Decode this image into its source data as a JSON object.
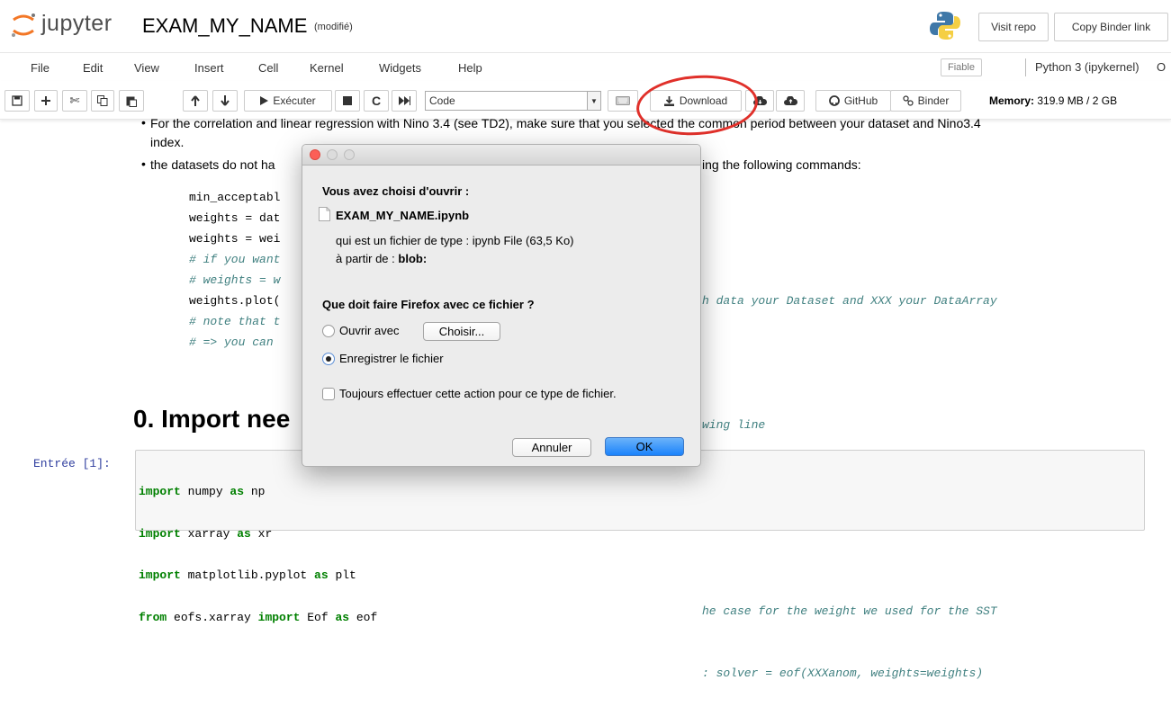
{
  "header": {
    "logo_text": "jupyter",
    "notebook_title": "EXAM_MY_NAME",
    "save_status": "(modifié)",
    "visit_repo": "Visit repo",
    "copy_binder_link": "Copy Binder link"
  },
  "menu": {
    "items": [
      "File",
      "Edit",
      "View",
      "Insert",
      "Cell",
      "Kernel",
      "Widgets",
      "Help"
    ],
    "trusted": "Fiable",
    "kernel": "Python 3 (ipykernel)",
    "kernel_indicator": "O"
  },
  "toolbar": {
    "run_label": "Exécuter",
    "cell_type": "Code",
    "download_label": "Download",
    "github_label": "GitHub",
    "binder_label": "Binder",
    "memory_label": "Memory:",
    "memory_value": "319.9 MB / 2 GB"
  },
  "notebook": {
    "bullet1_line1": "For the correlation and linear regression with Nino 3.4 (see TD2), make sure that you selected the common period between your dataset and Nino3.4",
    "bullet1_line2": "index.",
    "bullet2_left": "the datasets do not ha",
    "bullet2_right": "ing the following commands:",
    "code_left": [
      "min_acceptabl",
      "weights = dat",
      "weights = wei",
      "# if you want",
      "# weights = w",
      "weights.plot(",
      "# note that t",
      "# => you can "
    ],
    "code_right": [
      "",
      "h data your Dataset and XXX your DataArray",
      "",
      "wing line",
      "",
      "",
      "he case for the weight we used for the SST",
      ": solver = eof(XXXanom, weights=weights)"
    ],
    "heading": "0. Import nee",
    "prompt": "Entrée [1]:",
    "import_lines": [
      {
        "kw1": "import",
        "mod": " numpy ",
        "kw2": "as",
        "alias": " np"
      },
      {
        "kw1": "import",
        "mod": " xarray ",
        "kw2": "as",
        "alias": " xr"
      },
      {
        "kw1": "import",
        "mod": " matplotlib.pyplot ",
        "kw2": "as",
        "alias": " plt"
      },
      {
        "kw1": "from",
        "mod": " eofs.xarray ",
        "kw2": "import",
        "alias": " Eof ",
        "kw3": "as",
        "alias2": " eof"
      }
    ]
  },
  "dialog": {
    "heading": "Vous avez choisi d'ouvrir :",
    "filename": "EXAM_MY_NAME.ipynb",
    "file_type_prefix": "qui est un fichier de type :",
    "file_type": "ipynb File (63,5 Ko)",
    "source_prefix": "à partir de :",
    "source": "blob:",
    "question": "Que doit faire Firefox avec ce fichier ?",
    "open_with": "Ouvrir avec",
    "choose_button": "Choisir...",
    "save_file": "Enregistrer le fichier",
    "always_do": "Toujours effectuer cette action pour ce type de fichier.",
    "cancel": "Annuler",
    "ok": "OK",
    "save_selected": true
  },
  "colors": {
    "annotation": "#e0302a",
    "jupyter_orange": "#f37726",
    "primary_button": "#1a82fb"
  }
}
